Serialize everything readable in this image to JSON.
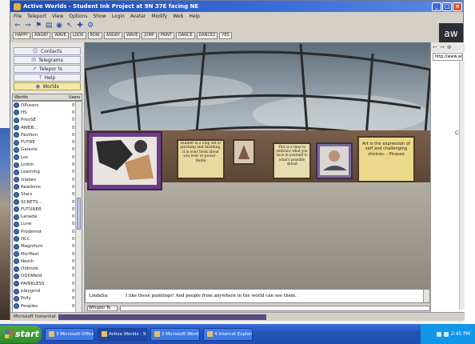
{
  "window": {
    "title": "Active Worlds - Student Ink Project at 9N 37E facing NE"
  },
  "menu": [
    "File",
    "Teleport",
    "View",
    "Options",
    "Show",
    "Login",
    "Avatar",
    "Modify",
    "Web",
    "Help"
  ],
  "toolbar_icons": [
    "back-arrow-icon",
    "forward-arrow-icon",
    "teleport-icon",
    "paste-icon",
    "camera-icon",
    "arrow-icon",
    "jump-icon",
    "settings-icon"
  ],
  "gestures": [
    "HAPPY",
    "ANGRY",
    "WAVE",
    "LOOK",
    "BOW",
    "ANGRY",
    "WAVE",
    "JUMP",
    "FAINT",
    "DANCE",
    "DANCE2",
    "YES"
  ],
  "logo": "aw",
  "nav": [
    {
      "label": "Contacts",
      "icon": "contacts-icon",
      "glyph": "☺"
    },
    {
      "label": "Telegrams",
      "icon": "telegram-icon",
      "glyph": "✉"
    },
    {
      "label": "Telepor ts",
      "icon": "teleport-icon",
      "glyph": "➚"
    },
    {
      "label": "Help",
      "icon": "help-icon",
      "glyph": "?"
    },
    {
      "label": "Worlds",
      "icon": "worlds-icon",
      "glyph": "◉"
    }
  ],
  "worlds_header": {
    "name": "Worlds",
    "count": "Users"
  },
  "worlds": [
    {
      "name": "OPusers",
      "count": "0"
    },
    {
      "name": "HS",
      "count": "0"
    },
    {
      "name": "ProvSE",
      "count": "0"
    },
    {
      "name": "AWEB...",
      "count": "0"
    },
    {
      "name": "Pavilion",
      "count": "0"
    },
    {
      "name": "FUTRE",
      "count": "0"
    },
    {
      "name": "Galaxie",
      "count": "0"
    },
    {
      "name": "Loc",
      "count": "0"
    },
    {
      "name": "Linkin",
      "count": "0"
    },
    {
      "name": "Learning",
      "count": "0"
    },
    {
      "name": "Islabes",
      "count": "0"
    },
    {
      "name": "Readsms",
      "count": "0"
    },
    {
      "name": "Stars",
      "count": "0"
    },
    {
      "name": "SCRETS...",
      "count": "0"
    },
    {
      "name": "FUTURER",
      "count": "0"
    },
    {
      "name": "Lanada",
      "count": "0"
    },
    {
      "name": "Lune",
      "count": "0"
    },
    {
      "name": "Prodemst",
      "count": "0"
    },
    {
      "name": "HCC",
      "count": "0"
    },
    {
      "name": "Magnitum",
      "count": "0"
    },
    {
      "name": "Morffest",
      "count": "0"
    },
    {
      "name": "Nesth",
      "count": "0"
    },
    {
      "name": "Oldmob",
      "count": "0"
    },
    {
      "name": "ODDWeld",
      "count": "0"
    },
    {
      "name": "PAINKLESS",
      "count": "0"
    },
    {
      "name": "playgrnd",
      "count": "0"
    },
    {
      "name": "Polly",
      "count": "0"
    },
    {
      "name": "Peoples",
      "count": "0"
    }
  ],
  "paintings": [
    "Rubber is a long set of patching and finishing, it is your book about you ever or power - Bulde",
    "This is a time to embrace what you have in yourself to what's possible ahead",
    "Art is the expression of self and challenging choices. - Picasso"
  ],
  "chat": {
    "speaker": "LindaSa:",
    "message": "I like these paintings! And people from anywhere in the world can see them."
  },
  "input": {
    "mode": "Whisper To"
  },
  "browser": {
    "address": "http://www.activeworlds.com",
    "text": "Cli"
  },
  "status": {
    "text": "Microsoft Instantiat"
  },
  "taskbar": {
    "start": "start",
    "tasks": [
      {
        "label": "3 Microsoft Office O...",
        "active": false
      },
      {
        "label": "Active Worlds - Stude...",
        "active": true
      },
      {
        "label": "2 Microsoft Word ...",
        "active": false
      },
      {
        "label": "4 Internet Explore",
        "active": false
      }
    ],
    "clock": "2:45 PM"
  }
}
